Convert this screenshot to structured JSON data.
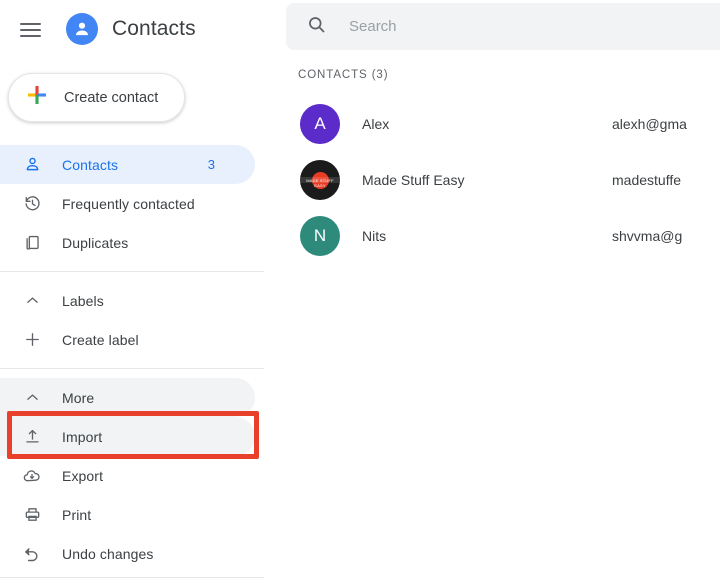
{
  "header": {
    "menu_icon": "hamburger-menu-icon",
    "brand_icon": "person-avatar-icon",
    "title": "Contacts"
  },
  "create_contact": {
    "label": "Create contact",
    "icon": "google-plus-icon"
  },
  "sidebar": {
    "items": [
      {
        "label": "Contacts",
        "icon": "person-outline-icon",
        "count": "3",
        "state": "selected"
      },
      {
        "label": "Frequently contacted",
        "icon": "history-clock-icon",
        "count": "",
        "state": "normal"
      },
      {
        "label": "Duplicates",
        "icon": "duplicate-pages-icon",
        "count": "",
        "state": "normal"
      },
      {
        "label": "Labels",
        "icon": "chevron-up-icon",
        "count": "",
        "state": "normal"
      },
      {
        "label": "Create label",
        "icon": "plus-icon",
        "count": "",
        "state": "normal"
      },
      {
        "label": "More",
        "icon": "chevron-up-icon",
        "count": "",
        "state": "hovered"
      },
      {
        "label": "Import",
        "icon": "upload-icon",
        "count": "",
        "state": "hovered"
      },
      {
        "label": "Export",
        "icon": "cloud-download-icon",
        "count": "",
        "state": "normal"
      },
      {
        "label": "Print",
        "icon": "printer-icon",
        "count": "",
        "state": "normal"
      },
      {
        "label": "Undo changes",
        "icon": "undo-arrow-icon",
        "count": "",
        "state": "normal"
      }
    ]
  },
  "annotation": {
    "target": "Import",
    "color": "#e8402a",
    "shape": "rectangle-outline"
  },
  "search": {
    "placeholder": "Search",
    "value": "",
    "icon": "search-icon"
  },
  "main": {
    "section_title": "CONTACTS (3)",
    "contacts": [
      {
        "name": "Alex",
        "email": "alexh@gma",
        "initial": "A",
        "avatar_color": "#5b2cc9",
        "avatar_type": "initial"
      },
      {
        "name": "Made Stuff Easy",
        "email": "madestuffe",
        "initial": "",
        "avatar_color": "#1b1b1b",
        "avatar_type": "photo",
        "photo_label": "MADE STUFF EASY"
      },
      {
        "name": "Nits",
        "email": "shvvma@g",
        "initial": "N",
        "avatar_color": "#2e8b7c",
        "avatar_type": "initial"
      }
    ]
  },
  "colors": {
    "accent_blue": "#1a73e8",
    "brand_blue": "#4285f4",
    "selected_bg": "#e8f0fe",
    "hover_bg": "#f1f3f4",
    "annotation_red": "#e8402a"
  }
}
